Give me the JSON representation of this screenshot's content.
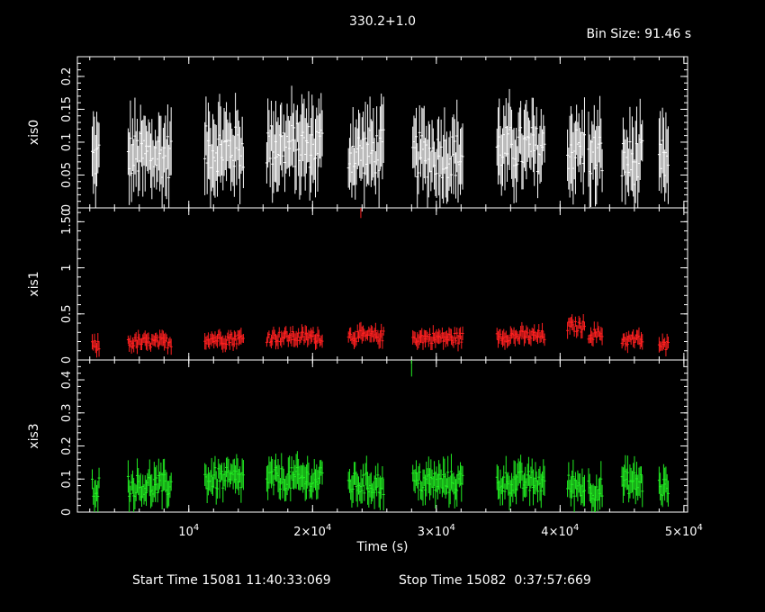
{
  "header": {
    "title": "330.2+1.0",
    "bin_size": "Bin Size: 91.46 s"
  },
  "footer": {
    "start_time": "Start Time 15081 11:40:33:069",
    "stop_time": "Stop Time 15082  0:37:57:669"
  },
  "chart_data": {
    "type": "scatter",
    "title": "330.2+1.0",
    "xlabel": "Time (s)",
    "xlim": [
      1000,
      50300
    ],
    "x_ticks": [
      {
        "v": 10000,
        "label": "10",
        "exp": "4"
      },
      {
        "v": 20000,
        "label": "2×10",
        "exp": "4"
      },
      {
        "v": 30000,
        "label": "3×10",
        "exp": "4"
      },
      {
        "v": 40000,
        "label": "4×10",
        "exp": "4"
      },
      {
        "v": 50000,
        "label": "5×10",
        "exp": "4"
      }
    ],
    "grid": false,
    "segments": [
      [
        2200,
        2800
      ],
      [
        5100,
        8600
      ],
      [
        11300,
        14500
      ],
      [
        16300,
        20800
      ],
      [
        22900,
        25800
      ],
      [
        28100,
        32200
      ],
      [
        34900,
        38800
      ],
      [
        40600,
        42000
      ],
      [
        42300,
        43400
      ],
      [
        45000,
        46700
      ],
      [
        48000,
        48800
      ]
    ],
    "panels": [
      {
        "name": "xis0",
        "ylabel": "xis0",
        "color": "#ffffff",
        "ylim": [
          0,
          0.23
        ],
        "ticks": [
          {
            "v": 0,
            "label": "0"
          },
          {
            "v": 0.05,
            "label": "0.05"
          },
          {
            "v": 0.1,
            "label": "0.1"
          },
          {
            "v": 0.15,
            "label": "0.15"
          },
          {
            "v": 0.2,
            "label": "0.2"
          }
        ],
        "segment_means": [
          0.075,
          0.08,
          0.09,
          0.095,
          0.085,
          0.08,
          0.09,
          0.09,
          0.08,
          0.07,
          0.07
        ],
        "spread": 0.035,
        "err": 0.045,
        "spikes": []
      },
      {
        "name": "xis1",
        "ylabel": "xis1",
        "color": "#ff2020",
        "ylim": [
          0,
          1.65
        ],
        "ticks": [
          {
            "v": 0,
            "label": "0"
          },
          {
            "v": 0.5,
            "label": "0.5"
          },
          {
            "v": 1,
            "label": "1"
          },
          {
            "v": 1.5,
            "label": "1.50"
          }
        ],
        "segment_means": [
          0.15,
          0.19,
          0.23,
          0.25,
          0.26,
          0.24,
          0.26,
          0.36,
          0.28,
          0.22,
          0.15
        ],
        "spread": 0.06,
        "err": 0.07,
        "spikes": [
          {
            "x": 23900,
            "y": 1.62,
            "err": 0.08
          }
        ]
      },
      {
        "name": "xis3",
        "ylabel": "xis3",
        "color": "#22ee22",
        "ylim": [
          0,
          0.46
        ],
        "ticks": [
          {
            "v": 0,
            "label": "0"
          },
          {
            "v": 0.1,
            "label": "0.1"
          },
          {
            "v": 0.2,
            "label": "0.2"
          },
          {
            "v": 0.3,
            "label": "0.3"
          },
          {
            "v": 0.4,
            "label": "0.4"
          }
        ],
        "segment_means": [
          0.08,
          0.08,
          0.1,
          0.1,
          0.085,
          0.09,
          0.09,
          0.08,
          0.07,
          0.09,
          0.075
        ],
        "spread": 0.035,
        "err": 0.04,
        "spikes": [
          {
            "x": 28000,
            "y": 0.44,
            "err": 0.03
          }
        ]
      }
    ]
  }
}
